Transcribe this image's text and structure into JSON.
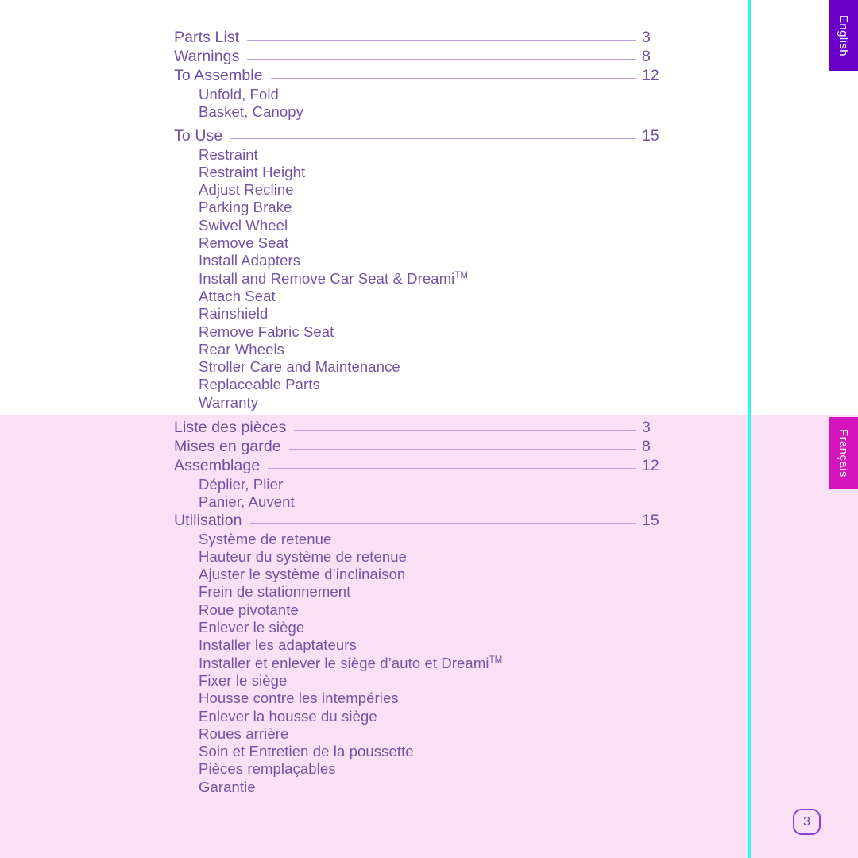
{
  "document": {
    "page_number": "3",
    "colors": {
      "heading_purple": "#6e4fa0",
      "sub_purple": "#7354a3",
      "leader_rule": "#bb9ede",
      "cyan_rule": "#2ff7fb",
      "english_tab": "#6a00c8",
      "french_tab": "#d513bd",
      "french_background": "#f9e0f5",
      "english_background": "#ffffff",
      "badge_border": "#8b3fd0"
    }
  },
  "tabs": {
    "english": "English",
    "french": "Français"
  },
  "english_toc": {
    "entries": [
      {
        "type": "main",
        "label": "Parts List",
        "page": "3"
      },
      {
        "type": "main",
        "label": "Warnings",
        "page": "8"
      },
      {
        "type": "main",
        "label": "To Assemble",
        "page": "12"
      },
      {
        "type": "sub",
        "label": "Unfold, Fold"
      },
      {
        "type": "sub",
        "label": "Basket, Canopy"
      },
      {
        "type": "gap"
      },
      {
        "type": "main",
        "label": "To Use",
        "page": "15"
      },
      {
        "type": "sub",
        "label": "Restraint"
      },
      {
        "type": "sub",
        "label": "Restraint Height"
      },
      {
        "type": "sub",
        "label": "Adjust Recline"
      },
      {
        "type": "sub",
        "label": "Parking Brake"
      },
      {
        "type": "sub",
        "label": "Swivel Wheel"
      },
      {
        "type": "sub",
        "label": "Remove Seat"
      },
      {
        "type": "sub",
        "label": "Install Adapters"
      },
      {
        "type": "sub",
        "label": "Install and Remove Car Seat & Dreami",
        "tm": "TM"
      },
      {
        "type": "sub",
        "label": "Attach Seat"
      },
      {
        "type": "sub",
        "label": "Rainshield"
      },
      {
        "type": "sub",
        "label": "Remove Fabric Seat"
      },
      {
        "type": "sub",
        "label": "Rear Wheels"
      },
      {
        "type": "sub",
        "label": "Stroller Care and Maintenance"
      },
      {
        "type": "sub",
        "label": "Replaceable Parts"
      },
      {
        "type": "sub",
        "label": "Warranty"
      }
    ]
  },
  "french_toc": {
    "entries": [
      {
        "type": "main",
        "label": "Liste des pièces",
        "page": "3"
      },
      {
        "type": "main",
        "label": "Mises en garde",
        "page": "8",
        "tight": true
      },
      {
        "type": "main",
        "label": "Assemblage",
        "page": "12"
      },
      {
        "type": "sub",
        "label": "Déplier, Plier"
      },
      {
        "type": "sub",
        "label": "Panier, Auvent"
      },
      {
        "type": "main",
        "label": "Utilisation",
        "page": "15"
      },
      {
        "type": "sub",
        "label": "Système de retenue"
      },
      {
        "type": "sub",
        "label": "Hauteur du système de retenue"
      },
      {
        "type": "sub",
        "label": "Ajuster le système d’inclinaison"
      },
      {
        "type": "sub",
        "label": "Frein de stationnement"
      },
      {
        "type": "sub",
        "label": "Roue pivotante"
      },
      {
        "type": "sub",
        "label": "Enlever le siège"
      },
      {
        "type": "sub",
        "label": "Installer les adaptateurs"
      },
      {
        "type": "sub",
        "label": "Installer et enlever le siège d’auto et Dreami",
        "tm": "TM"
      },
      {
        "type": "sub",
        "label": "Fixer le siège"
      },
      {
        "type": "sub",
        "label": "Housse contre les intempéries"
      },
      {
        "type": "sub",
        "label": "Enlever la housse du siège"
      },
      {
        "type": "sub",
        "label": "Roues arrière"
      },
      {
        "type": "sub",
        "label": "Soin et Entretien de la poussette"
      },
      {
        "type": "sub",
        "label": "Pièces remplaçables"
      },
      {
        "type": "sub",
        "label": "Garantie"
      }
    ]
  }
}
